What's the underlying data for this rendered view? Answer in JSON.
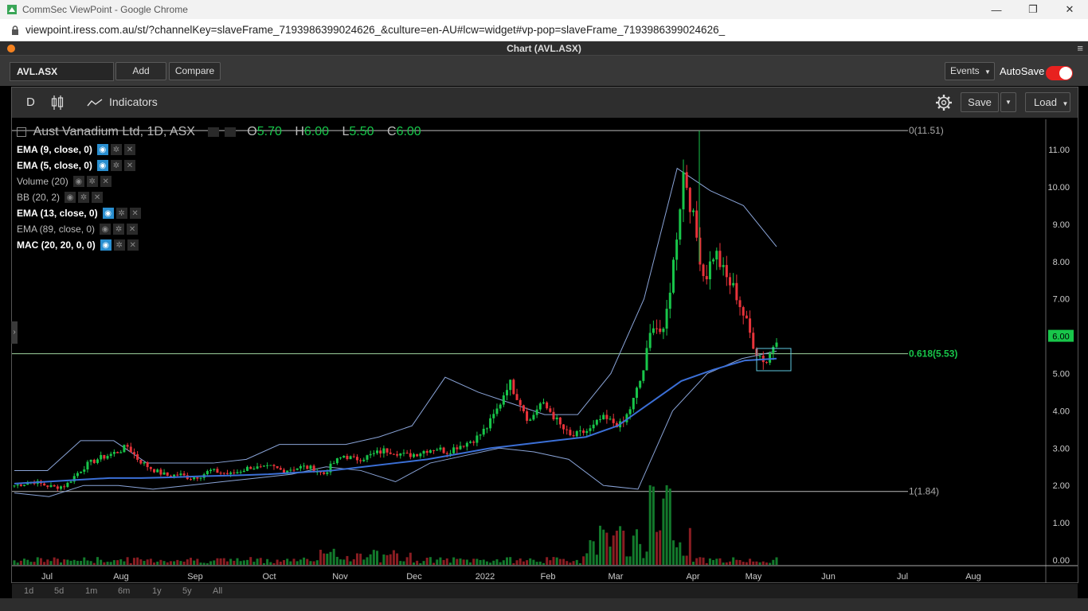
{
  "browser": {
    "window_title": "CommSec ViewPoint - Google Chrome",
    "url": "viewpoint.iress.com.au/st/?channelKey=slaveFrame_7193986399024626_&culture=en-AU#lcw=widget#vp-pop=slaveFrame_7193986399024626_",
    "minimize": "—",
    "restore": "❐",
    "close": "✕"
  },
  "app": {
    "title": "Chart (AVL.ASX)",
    "menu_icon": "≡"
  },
  "toolbar": {
    "symbol_value": "AVL.ASX",
    "add_label": "Add",
    "compare_label": "Compare",
    "events_label": "Events",
    "autosave_label": "AutoSave",
    "autosave_on": true
  },
  "chart_tools": {
    "interval": "D",
    "indicators_label": "Indicators",
    "save_label": "Save",
    "load_label": "Load"
  },
  "legend": {
    "title": "Aust Vanadium Ltd, 1D, ASX",
    "o_label": "O",
    "o_value": "5.70",
    "h_label": "H",
    "h_value": "6.00",
    "l_label": "L",
    "l_value": "5.50",
    "c_label": "C",
    "c_value": "6.00",
    "indicators": [
      {
        "name": "EMA (9, close, 0)",
        "visible": true
      },
      {
        "name": "EMA (5, close, 0)",
        "visible": true
      },
      {
        "name": "Volume (20)",
        "visible": false
      },
      {
        "name": "BB (20, 2)",
        "visible": false
      },
      {
        "name": "EMA (13, close, 0)",
        "visible": true
      },
      {
        "name": "EMA (89, close, 0)",
        "visible": false
      },
      {
        "name": "MAC (20, 20, 0, 0)",
        "visible": true
      }
    ]
  },
  "fib_labels": {
    "top": "0(11.51)",
    "mid": "0.618(5.53)",
    "bottom": "1(1.84)"
  },
  "last_price_label": "6.00",
  "timeframes": [
    "1d",
    "5d",
    "1m",
    "6m",
    "1y",
    "5y",
    "All"
  ],
  "colors": {
    "up": "#18c64a",
    "down": "#e8333a",
    "ema89": "#3b6fd6",
    "bb": "#8aa4d8",
    "fib": "#cfe8cf",
    "fib_label_mid": "#18c64a"
  },
  "chart_data": {
    "type": "candlestick",
    "title": "Aust Vanadium Ltd, 1D, ASX",
    "y_ticks": [
      "0.00",
      "1.00",
      "2.00",
      "3.00",
      "4.00",
      "5.00",
      "6.00",
      "7.00",
      "8.00",
      "9.00",
      "10.00",
      "11.00"
    ],
    "x_labels": [
      "Jul",
      "Aug",
      "Sep",
      "Oct",
      "Nov",
      "Dec",
      "2022",
      "Feb",
      "Mar",
      "Apr",
      "May",
      "Jun",
      "Jul",
      "Aug"
    ],
    "ylim": [
      1.6,
      11.6
    ],
    "fib_levels": [
      11.51,
      5.53,
      1.84
    ],
    "ohlc_close_path": [
      2.0,
      2.05,
      2.1,
      2.0,
      1.95,
      2.0,
      2.3,
      2.55,
      2.7,
      2.8,
      2.9,
      3.05,
      2.7,
      2.5,
      2.35,
      2.25,
      2.3,
      2.2,
      2.25,
      2.4,
      2.35,
      2.3,
      2.4,
      2.5,
      2.45,
      2.5,
      2.4,
      2.45,
      2.5,
      2.45,
      2.3,
      2.6,
      2.8,
      2.7,
      2.75,
      2.85,
      2.95,
      2.9,
      2.8,
      2.85,
      2.95,
      3.0,
      2.9,
      3.05,
      3.15,
      3.3,
      3.6,
      4.1,
      4.8,
      4.3,
      3.7,
      4.2,
      4.0,
      3.6,
      3.3,
      3.4,
      3.5,
      3.8,
      3.7,
      3.6,
      4.2,
      5.0,
      6.4,
      6.0,
      8.0,
      10.5,
      9.0,
      7.5,
      8.3,
      7.6,
      7.2,
      6.4,
      5.6,
      5.3,
      6.0
    ],
    "volume_max_label": "2.00",
    "ema89_path": [
      2.05,
      2.1,
      2.15,
      2.2,
      2.2,
      2.22,
      2.25,
      2.27,
      2.3,
      2.35,
      2.4,
      2.5,
      2.6,
      2.7,
      2.85,
      3.0,
      3.1,
      3.2,
      3.3,
      3.6,
      4.2,
      4.8,
      5.1,
      5.35,
      5.4
    ],
    "bb_upper_path": [
      2.4,
      2.4,
      3.2,
      3.2,
      2.6,
      2.6,
      2.6,
      2.7,
      3.1,
      3.1,
      3.1,
      3.3,
      3.6,
      4.9,
      4.5,
      4.2,
      3.9,
      3.9,
      5.0,
      7.0,
      10.5,
      9.9,
      9.5,
      8.4
    ],
    "bb_lower_path": [
      1.8,
      1.7,
      2.0,
      2.0,
      1.9,
      2.0,
      2.1,
      2.2,
      2.3,
      2.5,
      2.4,
      2.1,
      2.6,
      2.8,
      3.0,
      2.9,
      2.7,
      2.0,
      1.9,
      4.0,
      5.0,
      5.4,
      5.6
    ]
  }
}
